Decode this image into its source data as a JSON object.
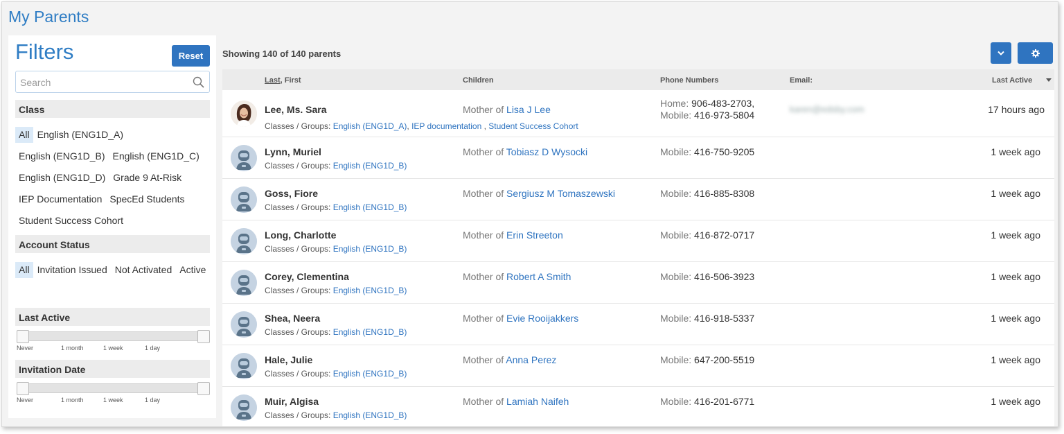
{
  "page": {
    "title": "My Parents"
  },
  "filters": {
    "title": "Filters",
    "reset_label": "Reset",
    "search_placeholder": "Search",
    "class": {
      "heading": "Class",
      "options": [
        "All",
        "English (ENG1D_A)",
        "English (ENG1D_B)",
        "English (ENG1D_C)",
        "English (ENG1D_D)",
        "Grade 9 At-Risk",
        "IEP Documentation",
        "SpecEd Students",
        "Student Success Cohort"
      ],
      "selected": "All"
    },
    "account_status": {
      "heading": "Account Status",
      "options": [
        "All",
        "Invitation Issued",
        "Not Activated",
        "Active"
      ],
      "selected": "All"
    },
    "last_active": {
      "heading": "Last Active",
      "ticks": [
        "Never",
        "1 month",
        "1 week",
        "1 day"
      ]
    },
    "invitation_date": {
      "heading": "Invitation Date",
      "ticks": [
        "Never",
        "1 month",
        "1 week",
        "1 day"
      ]
    }
  },
  "main": {
    "showing": "Showing 140 of 140 parents",
    "columns": {
      "last": "Last",
      "first": ", First",
      "children": "Children",
      "phones": "Phone Numbers",
      "email": "Email:",
      "last_active": "Last Active"
    },
    "rows": [
      {
        "name": "Lee, Ms. Sara",
        "groups_label": "Classes / Groups: ",
        "groups": [
          "English (ENG1D_A)",
          "IEP documentation",
          "Student Success Cohort"
        ],
        "relation": "Mother of ",
        "child": "Lisa J Lee",
        "phones": [
          {
            "label": "Home: ",
            "number": "906-483-2703,"
          },
          {
            "label": "Mobile: ",
            "number": "416-973-5804"
          }
        ],
        "email": "karen@edsby.com",
        "last_active": "17 hours ago",
        "avatar": "photo"
      },
      {
        "name": "Lynn, Muriel",
        "groups_label": "Classes / Groups: ",
        "groups": [
          "English (ENG1D_B)"
        ],
        "relation": "Mother of ",
        "child": "Tobiasz D Wysocki",
        "phones": [
          {
            "label": "Mobile: ",
            "number": "416-750-9205"
          }
        ],
        "email": "",
        "last_active": "1 week ago",
        "avatar": "default"
      },
      {
        "name": "Goss, Fiore",
        "groups_label": "Classes / Groups: ",
        "groups": [
          "English (ENG1D_B)"
        ],
        "relation": "Mother of ",
        "child": "Sergiusz M Tomaszewski",
        "phones": [
          {
            "label": "Mobile: ",
            "number": "416-885-8308"
          }
        ],
        "email": "",
        "last_active": "1 week ago",
        "avatar": "default"
      },
      {
        "name": "Long, Charlotte",
        "groups_label": "Classes / Groups: ",
        "groups": [
          "English (ENG1D_B)"
        ],
        "relation": "Mother of ",
        "child": "Erin Streeton",
        "phones": [
          {
            "label": "Mobile: ",
            "number": "416-872-0717"
          }
        ],
        "email": "",
        "last_active": "1 week ago",
        "avatar": "default"
      },
      {
        "name": "Corey, Clementina",
        "groups_label": "Classes / Groups: ",
        "groups": [
          "English (ENG1D_B)"
        ],
        "relation": "Mother of ",
        "child": "Robert A Smith",
        "phones": [
          {
            "label": "Mobile: ",
            "number": "416-506-3923"
          }
        ],
        "email": "",
        "last_active": "1 week ago",
        "avatar": "default"
      },
      {
        "name": "Shea, Neera",
        "groups_label": "Classes / Groups: ",
        "groups": [
          "English (ENG1D_B)"
        ],
        "relation": "Mother of ",
        "child": "Evie Rooijakkers",
        "phones": [
          {
            "label": "Mobile: ",
            "number": "416-918-5337"
          }
        ],
        "email": "",
        "last_active": "1 week ago",
        "avatar": "default"
      },
      {
        "name": "Hale, Julie",
        "groups_label": "Classes / Groups: ",
        "groups": [
          "English (ENG1D_B)"
        ],
        "relation": "Mother of ",
        "child": "Anna Perez",
        "phones": [
          {
            "label": "Mobile: ",
            "number": "647-200-5519"
          }
        ],
        "email": "",
        "last_active": "1 week ago",
        "avatar": "default"
      },
      {
        "name": "Muir, Algisa",
        "groups_label": "Classes / Groups: ",
        "groups": [
          "English (ENG1D_B)"
        ],
        "relation": "Mother of ",
        "child": "Lamiah Naifeh",
        "phones": [
          {
            "label": "Mobile: ",
            "number": "416-201-6771"
          }
        ],
        "email": "",
        "last_active": "1 week ago",
        "avatar": "default"
      }
    ]
  },
  "colors": {
    "accent": "#2f74c0",
    "title": "#2f7dc4",
    "chip_active": "#dbeaf8"
  }
}
